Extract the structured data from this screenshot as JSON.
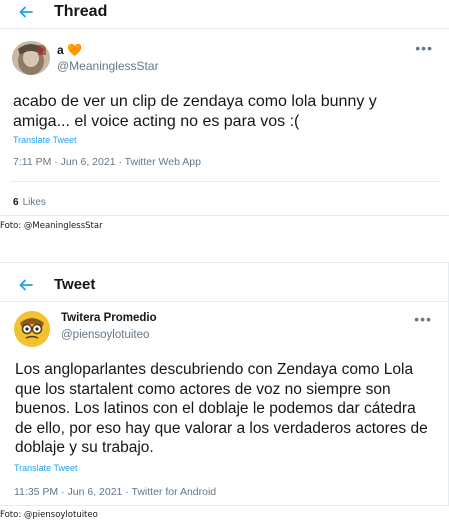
{
  "tweet1": {
    "header_title": "Thread",
    "display_name": "a 🧡",
    "handle": "@MeaninglessStar",
    "text": "acabo de ver un clip de zendaya como lola bunny y amiga... el voice acting no es para vos :(",
    "translate_label": "Translate Tweet",
    "meta": "7:11 PM · Jun 6, 2021 · Twitter Web App",
    "likes_count": "6",
    "likes_label": "Likes",
    "caption": "Foto: @MeaninglessStar"
  },
  "tweet2": {
    "header_title": "Tweet",
    "display_name": "Twitera Promedio",
    "handle": "@piensoylotuiteo",
    "text": "Los angloparlantes descubriendo con Zendaya como Lola que los startalent como actores de voz no siempre son buenos. Los latinos con el doblaje le podemos dar cátedra de ello, por eso hay que valorar a los verdaderos actores de doblaje y su trabajo.",
    "translate_label": "Translate Tweet",
    "meta": "11:35 PM · Jun 6, 2021 · Twitter for Android",
    "caption": "Foto: @piensoylotuiteo"
  },
  "icons": {
    "back": "back-arrow-icon",
    "more": "more-options-icon"
  },
  "colors": {
    "accent": "#1da1f2",
    "secondary_text": "#657786",
    "border": "#e6ecf0"
  }
}
